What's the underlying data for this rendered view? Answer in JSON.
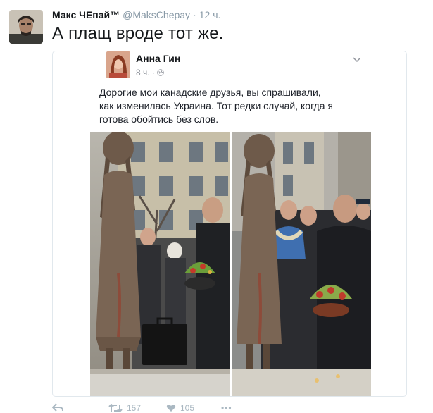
{
  "tweet": {
    "author_name": "Макс ЧЕпай™",
    "author_handle": "@MaksChepay",
    "separator": "·",
    "time": "12 ч.",
    "text": "А плащ вроде тот же."
  },
  "embed": {
    "post_author": "Анна Гин",
    "post_meta": "8 ч. · ",
    "post_lines": [
      "Дорогие мои канадские друзья, вы спрашивали,",
      "как изменилась Украина. Тот редки случай, когда я",
      "готова обойтись без слов."
    ]
  },
  "actions": {
    "reply_icon": "reply-icon",
    "retweet_count": "157",
    "like_count": "105",
    "more_label": "•••"
  },
  "colors": {
    "text": "#14171a",
    "secondary": "#8899a6",
    "border": "#e1e8ed",
    "action": "#aab8c2"
  }
}
